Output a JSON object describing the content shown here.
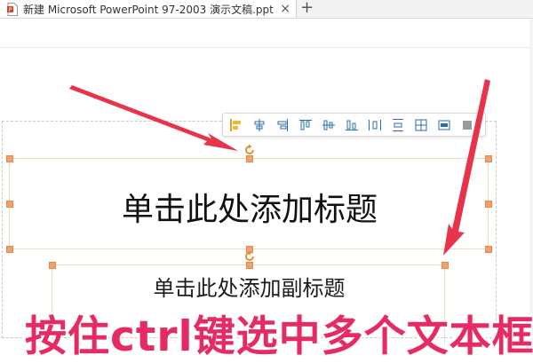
{
  "window": {
    "tab_title": "新建 Microsoft PowerPoint 97-2003 演示文稿.ppt",
    "close_glyph": "×",
    "add_glyph": "+"
  },
  "toolbar": {
    "buttons": [
      "align-left-icon",
      "align-center-icon",
      "align-right-icon",
      "align-top-icon",
      "align-middle-icon",
      "align-bottom-icon",
      "distribute-horizontal-icon",
      "distribute-vertical-icon",
      "equal-size-icon",
      "grid-icon",
      "more-icon"
    ]
  },
  "slide": {
    "title_placeholder": "单击此处添加标题",
    "subtitle_placeholder": "单击此处添加副标题"
  },
  "annotation": {
    "caption": "按住ctrl键选中多个文本框",
    "color": "#e62a64"
  },
  "colors": {
    "handle": "#f0a06b",
    "arrow": "#e8334b"
  }
}
